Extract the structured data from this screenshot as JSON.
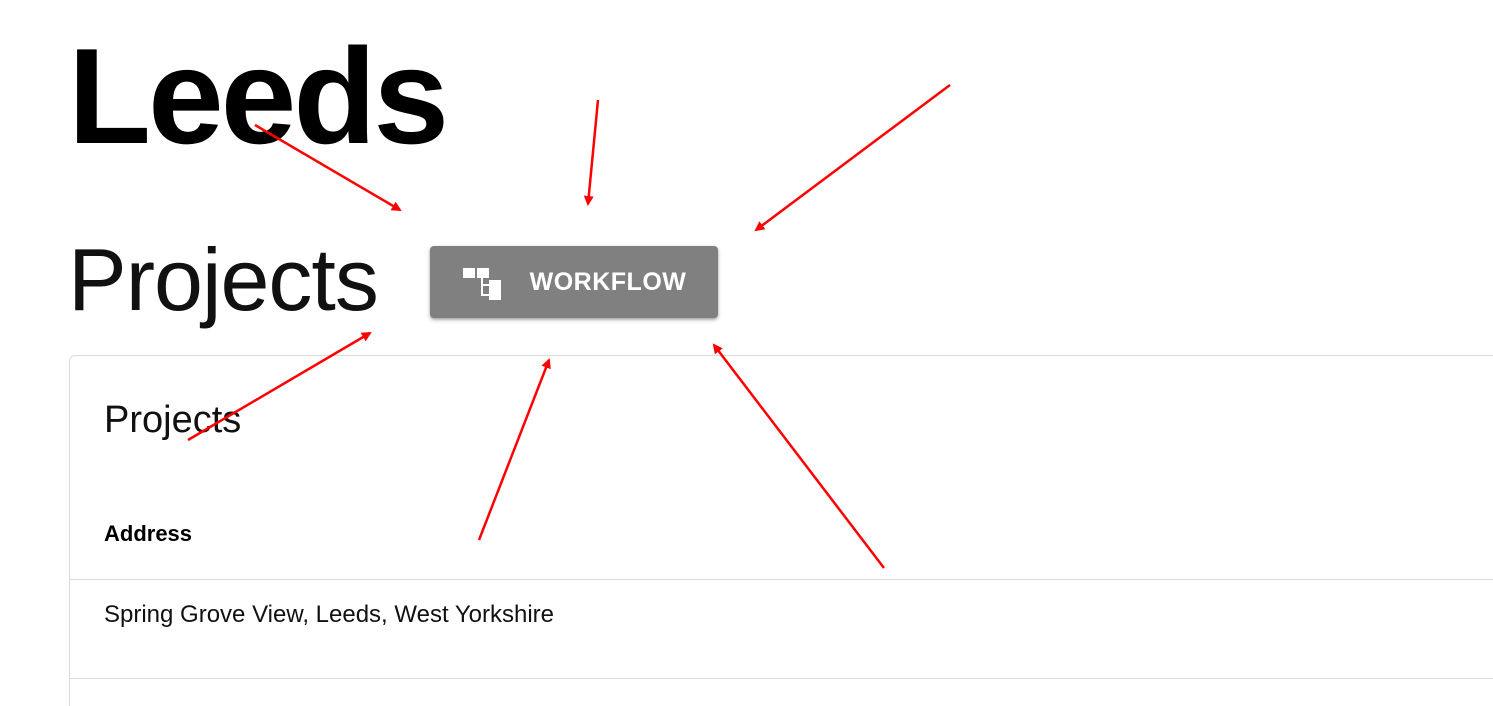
{
  "header": {
    "city": "Leeds",
    "section": "Projects"
  },
  "toolbar": {
    "workflow_label": "WORKFLOW",
    "workflow_icon": "workflow-tree-icon"
  },
  "card": {
    "title": "Projects",
    "columns": [
      "Address"
    ],
    "rows": [
      {
        "address": "Spring Grove View, Leeds, West Yorkshire"
      }
    ]
  },
  "colors": {
    "button_bg": "#808080",
    "button_text": "#ffffff",
    "annotation_arrow": "#ff0000",
    "divider": "#dcdcdc"
  }
}
